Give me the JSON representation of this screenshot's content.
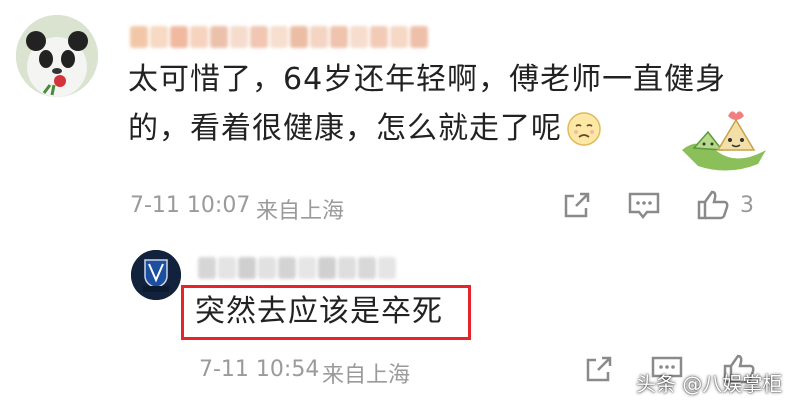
{
  "comment": {
    "text_line1": "太可惜了，64岁还年轻啊，傅老师一直健身",
    "text_line2": "的，看着很健康，怎么就走了呢",
    "emoji_icon": "sad-face-emoji-icon",
    "time": "7-11 10:07",
    "source": "来自上海",
    "like_count": "3"
  },
  "reply": {
    "text": "突然去应该是卒死",
    "time": "7-11 10:54",
    "source": "来自上海",
    "highlight_color": "#e8242b"
  },
  "watermark": {
    "text": "头条 @八娱掌柜"
  },
  "colors": {
    "background": "#ffffff",
    "meta_text": "#9a9a9a",
    "icon": "#8a8a8a"
  }
}
